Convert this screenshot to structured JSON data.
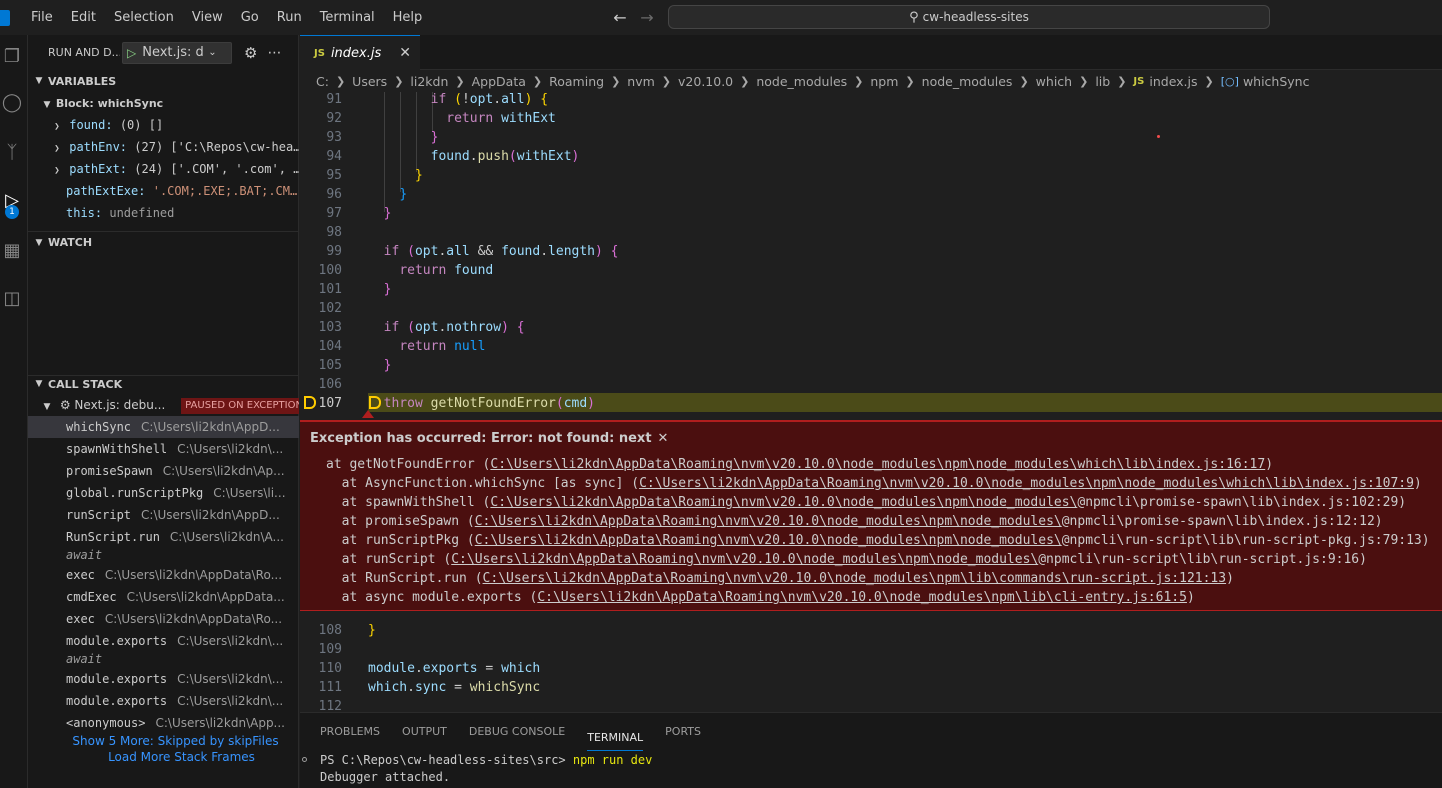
{
  "title_bar": {
    "menus": [
      "File",
      "Edit",
      "Selection",
      "View",
      "Go",
      "Run",
      "Terminal",
      "Help"
    ],
    "search_text": "cw-headless-sites"
  },
  "activity_bar": {
    "icons": [
      "explorer-icon",
      "search-icon",
      "source-control-icon",
      "run-debug-icon",
      "extensions-icon",
      "remote-explorer-icon"
    ],
    "debug_badge": "1"
  },
  "sidebar": {
    "run_title": "RUN AND D...",
    "config_label": "Next.js: de",
    "variables": {
      "header": "VARIABLES",
      "scope": "Block: whichSync",
      "items": [
        {
          "name": "found:",
          "value": "(0) []",
          "expandable": true
        },
        {
          "name": "pathEnv:",
          "value": "(27) ['C:\\Repos\\cw-hea…",
          "expandable": true
        },
        {
          "name": "pathExt:",
          "value": "(24) ['.COM', '.com', …",
          "expandable": true
        },
        {
          "name": "pathExtExe:",
          "value": "'.COM;.EXE;.BAT;.CM…",
          "expandable": false
        },
        {
          "name": "this:",
          "value": "undefined",
          "expandable": false
        }
      ]
    },
    "watch": {
      "header": "WATCH"
    },
    "call_stack": {
      "header": "CALL STACK",
      "session": "Next.js: debu...",
      "paused_badge": "PAUSED ON EXCEPTION",
      "frames": [
        {
          "name": "whichSync",
          "path": "C:\\Users\\li2kdn\\AppD..."
        },
        {
          "name": "spawnWithShell",
          "path": "C:\\Users\\li2kdn\\..."
        },
        {
          "name": "promiseSpawn",
          "path": "C:\\Users\\li2kdn\\Ap..."
        },
        {
          "name": "global.runScriptPkg",
          "path": "C:\\Users\\li..."
        },
        {
          "name": "runScript",
          "path": "C:\\Users\\li2kdn\\AppD..."
        },
        {
          "name": "RunScript.run",
          "path": "C:\\Users\\li2kdn\\A..."
        },
        {
          "name": "await",
          "path": ""
        },
        {
          "name": "exec",
          "path": "C:\\Users\\li2kdn\\AppData\\Ro..."
        },
        {
          "name": "cmdExec",
          "path": "C:\\Users\\li2kdn\\AppData..."
        },
        {
          "name": "exec",
          "path": "C:\\Users\\li2kdn\\AppData\\Ro..."
        },
        {
          "name": "module.exports",
          "path": "C:\\Users\\li2kdn\\..."
        },
        {
          "name": "await",
          "path": ""
        },
        {
          "name": "module.exports",
          "path": "C:\\Users\\li2kdn\\..."
        },
        {
          "name": "module.exports",
          "path": "C:\\Users\\li2kdn\\..."
        },
        {
          "name": "<anonymous>",
          "path": "C:\\Users\\li2kdn\\App..."
        }
      ],
      "show_more": "Show 5 More: Skipped by skipFiles",
      "load_more": "Load More Stack Frames"
    }
  },
  "editor": {
    "tab": {
      "icon_text": "JS",
      "label": "index.js"
    },
    "breadcrumbs": [
      "C:",
      "Users",
      "li2kdn",
      "AppData",
      "Roaming",
      "nvm",
      "v20.10.0",
      "node_modules",
      "npm",
      "node_modules",
      "which",
      "lib"
    ],
    "breadcrumb_file": "index.js",
    "breadcrumb_symbol": "whichSync",
    "line_numbers": [
      "91",
      "92",
      "93",
      "94",
      "95",
      "96",
      "97",
      "98",
      "99",
      "100",
      "101",
      "102",
      "103",
      "104",
      "105",
      "106",
      "107",
      "108",
      "109",
      "110",
      "111",
      "112"
    ],
    "exception": {
      "title": "Exception has occurred: Error: not found: next",
      "stack": [
        {
          "prefix": "at getNotFoundError (",
          "link": "C:\\Users\\li2kdn\\AppData\\Roaming\\nvm\\v20.10.0\\node_modules\\npm\\node_modules\\which\\lib\\index.js:16:17",
          "suffix": ")"
        },
        {
          "prefix": "  at AsyncFunction.whichSync [as sync] (",
          "link": "C:\\Users\\li2kdn\\AppData\\Roaming\\nvm\\v20.10.0\\node_modules\\npm\\node_modules\\which\\lib\\index.js:107:9",
          "suffix": ")"
        },
        {
          "prefix": "  at spawnWithShell (",
          "link": "C:\\Users\\li2kdn\\AppData\\Roaming\\nvm\\v20.10.0\\node_modules\\npm\\node_modules\\",
          "suffix": "@npmcli\\promise-spawn\\lib\\index.js:102:29)"
        },
        {
          "prefix": "  at promiseSpawn (",
          "link": "C:\\Users\\li2kdn\\AppData\\Roaming\\nvm\\v20.10.0\\node_modules\\npm\\node_modules\\",
          "suffix": "@npmcli\\promise-spawn\\lib\\index.js:12:12)"
        },
        {
          "prefix": "  at runScriptPkg (",
          "link": "C:\\Users\\li2kdn\\AppData\\Roaming\\nvm\\v20.10.0\\node_modules\\npm\\node_modules\\",
          "suffix": "@npmcli\\run-script\\lib\\run-script-pkg.js:79:13)"
        },
        {
          "prefix": "  at runScript (",
          "link": "C:\\Users\\li2kdn\\AppData\\Roaming\\nvm\\v20.10.0\\node_modules\\npm\\node_modules\\",
          "suffix": "@npmcli\\run-script\\lib\\run-script.js:9:16)"
        },
        {
          "prefix": "  at RunScript.run (",
          "link": "C:\\Users\\li2kdn\\AppData\\Roaming\\nvm\\v20.10.0\\node_modules\\npm\\lib\\commands\\run-script.js:121:13",
          "suffix": ")"
        },
        {
          "prefix": "  at async module.exports (",
          "link": "C:\\Users\\li2kdn\\AppData\\Roaming\\nvm\\v20.10.0\\node_modules\\npm\\lib\\cli-entry.js:61:5",
          "suffix": ")"
        }
      ]
    }
  },
  "panel": {
    "tabs": [
      "PROBLEMS",
      "OUTPUT",
      "DEBUG CONSOLE",
      "TERMINAL",
      "PORTS"
    ],
    "active_tab": "TERMINAL",
    "terminal": {
      "prompt": "PS C:\\Repos\\cw-headless-sites\\src> ",
      "command": "npm run dev",
      "output": "Debugger attached."
    }
  }
}
